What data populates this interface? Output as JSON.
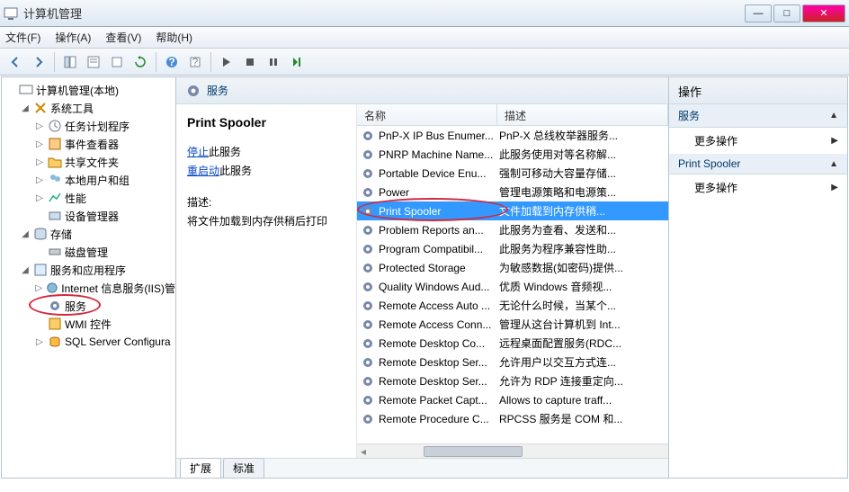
{
  "window": {
    "title": "计算机管理"
  },
  "menu": {
    "file": "文件(F)",
    "action": "操作(A)",
    "view": "查看(V)",
    "help": "帮助(H)"
  },
  "tree": {
    "root": "计算机管理(本地)",
    "sys_tools": "系统工具",
    "task_sched": "任务计划程序",
    "event_viewer": "事件查看器",
    "shared": "共享文件夹",
    "local_users": "本地用户和组",
    "perf": "性能",
    "device_mgr": "设备管理器",
    "storage": "存储",
    "disk_mgmt": "磁盘管理",
    "svc_apps": "服务和应用程序",
    "iis": "Internet 信息服务(IIS)管",
    "services": "服务",
    "wmi": "WMI 控件",
    "sql": "SQL Server Configura"
  },
  "mid": {
    "header": "服务",
    "selected_name": "Print Spooler",
    "stop_link": "停止",
    "stop_suffix": "此服务",
    "restart_link": "重启动",
    "restart_suffix": "此服务",
    "desc_label": "描述:",
    "desc_text": "将文件加载到内存供稍后打印",
    "col_name": "名称",
    "col_desc": "描述",
    "tabs": {
      "ext": "扩展",
      "std": "标准"
    }
  },
  "services": [
    {
      "name": "PnP-X IP Bus Enumer...",
      "desc": "PnP-X 总线枚举器服务..."
    },
    {
      "name": "PNRP Machine Name...",
      "desc": "此服务使用对等名称解..."
    },
    {
      "name": "Portable Device Enu...",
      "desc": "强制可移动大容量存储..."
    },
    {
      "name": "Power",
      "desc": "管理电源策略和电源策..."
    },
    {
      "name": "Print Spooler",
      "desc": "  文件加载到内存供稍...",
      "selected": true
    },
    {
      "name": "Problem Reports an...",
      "desc": "此服务为查看、发送和..."
    },
    {
      "name": "Program Compatibil...",
      "desc": "此服务为程序兼容性助..."
    },
    {
      "name": "Protected Storage",
      "desc": "为敏感数据(如密码)提供..."
    },
    {
      "name": "Quality Windows Aud...",
      "desc": "优质 Windows 音频视..."
    },
    {
      "name": "Remote Access Auto ...",
      "desc": "无论什么时候，当某个..."
    },
    {
      "name": "Remote Access Conn...",
      "desc": "管理从这台计算机到 Int..."
    },
    {
      "name": "Remote Desktop Co...",
      "desc": "远程桌面配置服务(RDC..."
    },
    {
      "name": "Remote Desktop Ser...",
      "desc": "允许用户以交互方式连..."
    },
    {
      "name": "Remote Desktop Ser...",
      "desc": "允许为 RDP 连接重定向..."
    },
    {
      "name": "Remote Packet Capt...",
      "desc": "Allows to capture traff..."
    },
    {
      "name": "Remote Procedure C...",
      "desc": "RPCSS 服务是 COM 和..."
    }
  ],
  "actions": {
    "title": "操作",
    "sec1": "服务",
    "more": "更多操作",
    "sec2": "Print Spooler"
  }
}
